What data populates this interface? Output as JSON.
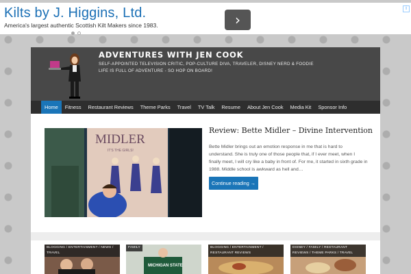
{
  "ad": {
    "title": "Kilts by J. Higgins, Ltd.",
    "subtitle": "America's largest authentic Scottish Kilt Makers since 1983.",
    "next_icon": "chevron-right-icon",
    "arrow_glyph": "›",
    "info_glyph": "i"
  },
  "site": {
    "title": "ADVENTURES WITH JEN COOK",
    "tagline_1": "SELF-APPOINTED TELEVISION CRITIC, POP-CULTURE DIVA, TRAVELER, DISNEY NERD & FOODIE",
    "tagline_2": "LIFE IS FULL OF ADVENTURE - SO HOP ON BOARD!"
  },
  "nav": {
    "items": [
      "Home",
      "Fitness",
      "Restaurant Reviews",
      "Theme Parks",
      "Travel",
      "TV Talk",
      "Resume",
      "About Jen Cook",
      "Media Kit",
      "Sponsor Info"
    ],
    "active_index": 0
  },
  "post": {
    "title": "Review: Bette Midler – Divine Intervention",
    "excerpt": "Bette Midler brings out an emotion response in me that is hard to understand.  She is truly one of those people that, if I ever meet, when I finally meet, I will cry like a baby in front of. For me, it started in sixth grade in 1988.  Middle school is awkward as hell and…",
    "read_more": "Continue reading →",
    "image_text_1": "MIDLER",
    "image_text_2": "IT'S THE GIRLS!"
  },
  "thumbs": [
    {
      "tags": "BLOGGING / ENTERTAINMENT / NEWS / TRAVEL"
    },
    {
      "tags": "FAMILY",
      "shirt_text": "MICHIGAN STATE"
    },
    {
      "tags": "BLOGGING / ENTERTAINMENT / RESTAURANT REVIEWS"
    },
    {
      "tags": "DISNEY / FAMILY / RESTAURANT REVIEWS / THEME PARKS / TRAVEL"
    }
  ],
  "colors": {
    "accent": "#1a75b8",
    "header_bg": "#484848",
    "nav_bg": "#2e2e2e",
    "ad_link": "#1a6fb5"
  }
}
